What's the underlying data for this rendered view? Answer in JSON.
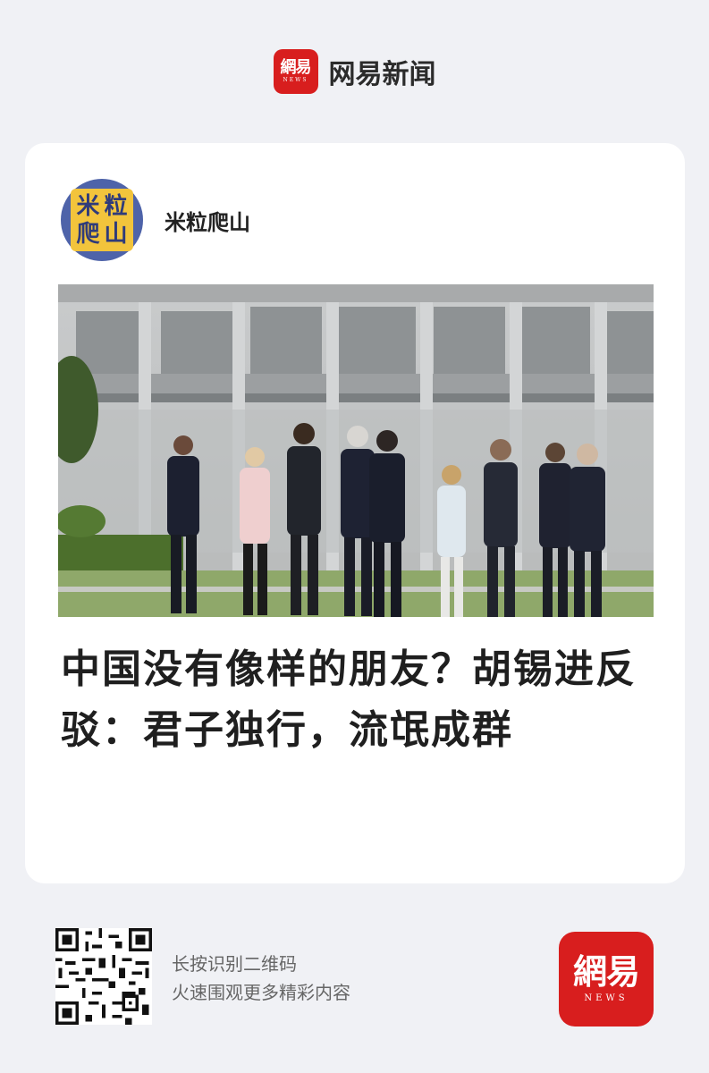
{
  "header": {
    "logo_text": "網易",
    "logo_sub": "NEWS",
    "app_name": "网易新闻"
  },
  "author": {
    "avatar_chars": [
      "米",
      "粒",
      "爬",
      "山"
    ],
    "name": "米粒爬山"
  },
  "article": {
    "headline": "中国没有像样的朋友？胡锡进反驳：君子独行，流氓成群"
  },
  "footer": {
    "qr_line1": "长按识别二维码",
    "qr_line2": "火速围观更多精彩内容",
    "logo_text": "網易",
    "logo_sub": "NEWS"
  },
  "colors": {
    "brand_red": "#d81e1e",
    "background": "#f0f1f5",
    "card": "#ffffff"
  }
}
